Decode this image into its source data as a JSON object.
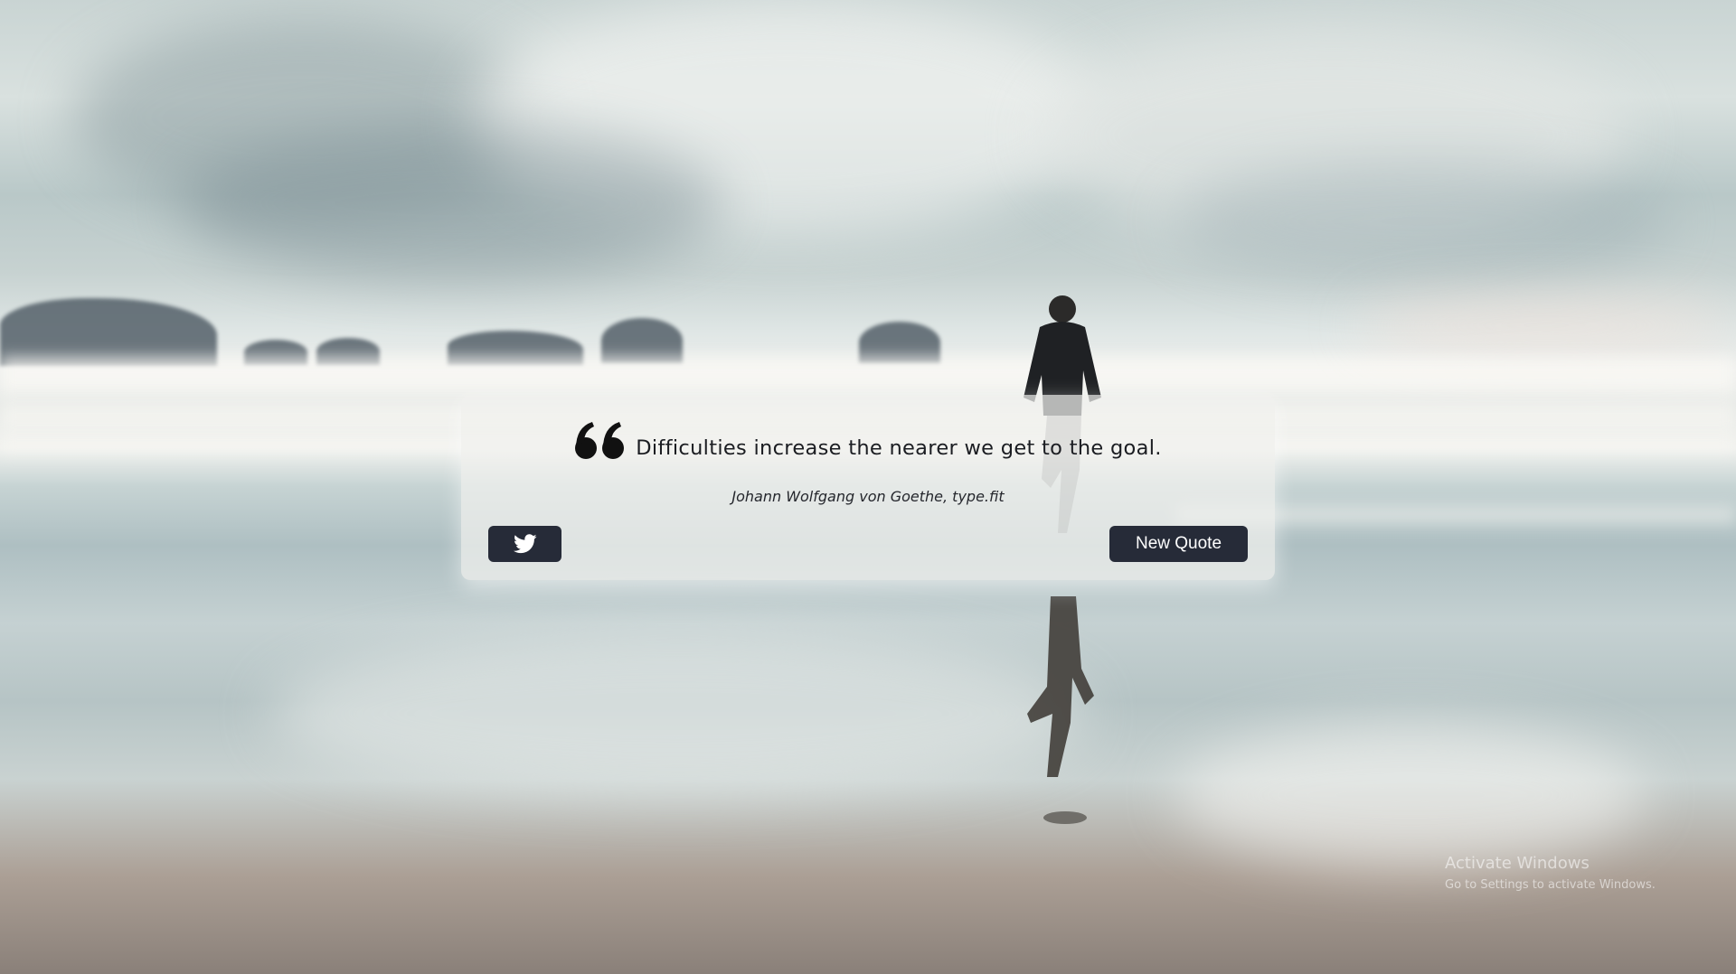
{
  "quote": {
    "text": "Difficulties increase the nearer we get to the goal.",
    "author": "Johann Wolfgang von Goethe, type.fit"
  },
  "buttons": {
    "tweet_icon": "twitter-icon",
    "new_quote_label": "New Quote"
  },
  "watermark": {
    "title": "Activate Windows",
    "subtitle": "Go to Settings to activate Windows."
  },
  "colors": {
    "button_bg": "#262b38",
    "card_bg": "#f1f1ee",
    "text": "#1b1d22"
  }
}
